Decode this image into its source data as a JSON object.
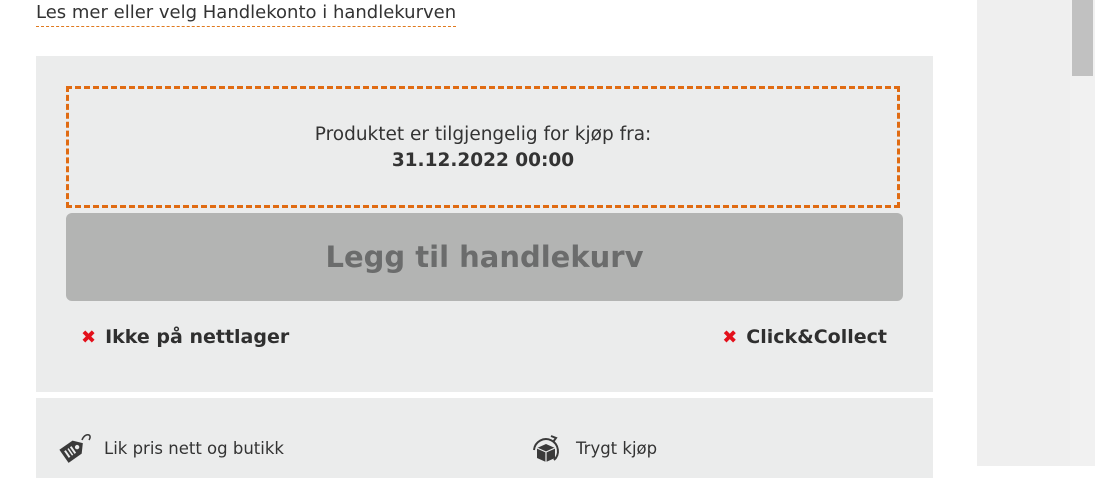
{
  "info_link": "Les mer eller velg Handlekonto i handlekurven",
  "availability": {
    "text": "Produktet er tilgjengelig for kjøp fra:",
    "date": "31.12.2022 00:00"
  },
  "cart_button": "Legg til handlekurv",
  "status": {
    "left_label": "Ikke på nettlager",
    "right_label": "Click&Collect",
    "icon": "x-icon",
    "color": "#e3101b"
  },
  "features": [
    {
      "label": "Lik pris nett og butikk",
      "icon": "price-tag-icon"
    },
    {
      "label": "Trygt kjøp",
      "icon": "secure-package-icon"
    }
  ],
  "colors": {
    "accent": "#e06b12",
    "panel": "#ebecec",
    "button_disabled": "#b3b4b3"
  }
}
